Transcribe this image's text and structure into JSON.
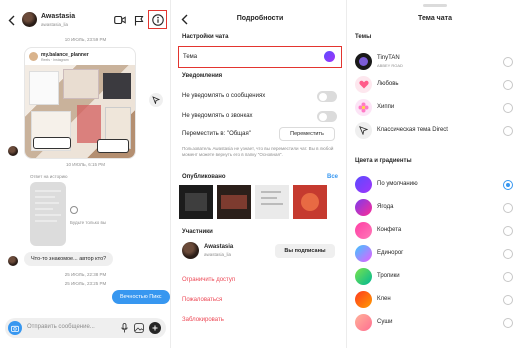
{
  "chat": {
    "username": "Awastasia",
    "username_sub": "awastasia_lia",
    "timestamp1": "10 ИЮЛЬ, 23:59 PM",
    "post_account": "my.balance_planner",
    "post_sub": "Reels · Instagram",
    "read_time": "10 ИЮЛЬ, 6:15 PM",
    "story_caption": "Ответ на историю",
    "reply_label": "Будьте только вы",
    "received_message": "Что-то знакомое... автор кто?",
    "timestamp2": "25 ИЮЛЬ, 22:38 PM",
    "timestamp3": "25 ИЮЛЬ, 23:25 PM",
    "sent_message": "Вечностью Пикс",
    "input_placeholder": "Отправить сообщение..."
  },
  "details": {
    "title": "Подробности",
    "section_chat_settings": "Настройки чата",
    "theme_label": "Тема",
    "section_notifications": "Уведомления",
    "mute_messages": "Не уведомлять о сообщениях",
    "mute_calls": "Не уведомлять о звонках",
    "move_label": "Переместить в: \"Общая\"",
    "move_button": "Переместить",
    "move_hint": "Пользователь Awastasia не узнает, что вы переместили чат. Вы в любой момент можете вернуть его в папку \"Основная\".",
    "published_label": "Опубликовано",
    "published_all": "Все",
    "participants_label": "Участники",
    "participant_name": "Awastasia",
    "participant_handle": "awastasia_lia",
    "following_button": "Вы подписаны",
    "restrict": "Ограничить доступ",
    "report": "Пожаловаться",
    "block": "Заблокировать"
  },
  "themes": {
    "title": "Тема чата",
    "section_themes": "Темы",
    "items": [
      {
        "label": "TinyTAN",
        "sub": "ABBEY ROAD"
      },
      {
        "label": "Любовь"
      },
      {
        "label": "Хиппи"
      },
      {
        "label": "Классическая тема Direct"
      }
    ],
    "section_colors": "Цвета и градиенты",
    "colors": [
      {
        "label": "По умолчанию",
        "c1": "#5a4bff",
        "c2": "#a233fa",
        "selected": true
      },
      {
        "label": "Ягода",
        "c1": "#7c3aed",
        "c2": "#ff2d95",
        "selected": false
      },
      {
        "label": "Конфета",
        "c1": "#ff3ea5",
        "c2": "#ff7ab8",
        "selected": false
      },
      {
        "label": "Единорог",
        "c1": "#3cc6ff",
        "c2": "#e95cff",
        "selected": false
      },
      {
        "label": "Тропики",
        "c1": "#7be34b",
        "c2": "#00b894",
        "selected": false
      },
      {
        "label": "Клен",
        "c1": "#ff3a1f",
        "c2": "#ff9d00",
        "selected": false
      },
      {
        "label": "Суши",
        "c1": "#ffb199",
        "c2": "#ff6f91",
        "selected": false
      }
    ]
  },
  "colors": {
    "accent": "#3797f0",
    "danger": "#ed4956",
    "highlight": "#e3352f"
  }
}
